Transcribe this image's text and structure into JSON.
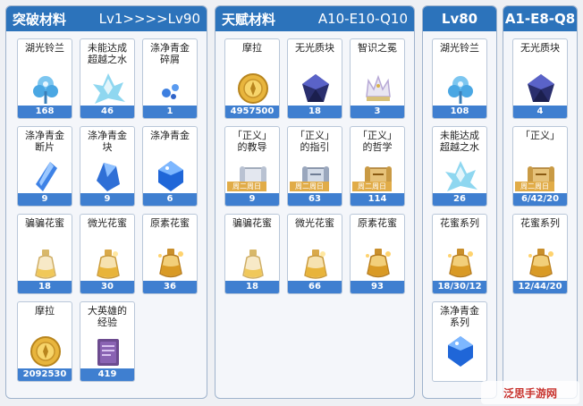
{
  "panels": {
    "breakthrough": {
      "title": "突破材料",
      "range": "Lv1>>>>Lv90",
      "items": [
        {
          "name": "湖光铃兰",
          "count": "168",
          "icon": "lake-lily-icon"
        },
        {
          "name": "未能达成\n超越之水",
          "count": "46",
          "icon": "water-crystal-icon"
        },
        {
          "name": "涤净青金\n碎屑",
          "count": "1",
          "icon": "lapis-sliver-icon"
        },
        {
          "name": "涤净青金\n断片",
          "count": "9",
          "icon": "lapis-fragment-icon"
        },
        {
          "name": "涤净青金\n块",
          "count": "9",
          "icon": "lapis-chunk-icon"
        },
        {
          "name": "涤净青金",
          "count": "6",
          "icon": "lapis-gemstone-icon"
        },
        {
          "name": "骗骗花蜜",
          "count": "18",
          "icon": "nectar-bottle-icon"
        },
        {
          "name": "微光花蜜",
          "count": "30",
          "icon": "shimmering-nectar-icon"
        },
        {
          "name": "原素花蜜",
          "count": "36",
          "icon": "energy-nectar-icon"
        },
        {
          "name": "摩拉",
          "count": "2092530",
          "icon": "mora-coin-icon"
        },
        {
          "name": "大英雄的\n经验",
          "count": "419",
          "icon": "hero-wit-book-icon"
        }
      ]
    },
    "talent": {
      "title": "天赋材料",
      "range": "A10-E10-Q10",
      "items": [
        {
          "name": "摩拉",
          "count": "4957500",
          "icon": "mora-coin-icon"
        },
        {
          "name": "无光质块",
          "count": "18",
          "icon": "lightless-mass-icon"
        },
        {
          "name": "智识之冕",
          "count": "3",
          "icon": "crown-of-insight-icon"
        },
        {
          "name": "「正义」\n的教导",
          "count": "9",
          "icon": "justice-teachings-icon",
          "tag": "周二周日"
        },
        {
          "name": "「正义」\n的指引",
          "count": "63",
          "icon": "justice-guide-icon",
          "tag": "周二周日"
        },
        {
          "name": "「正义」\n的哲学",
          "count": "114",
          "icon": "justice-philosophies-icon",
          "tag": "周二周日"
        },
        {
          "name": "骗骗花蜜",
          "count": "18",
          "icon": "nectar-bottle-icon"
        },
        {
          "name": "微光花蜜",
          "count": "66",
          "icon": "shimmering-nectar-icon"
        },
        {
          "name": "原素花蜜",
          "count": "93",
          "icon": "energy-nectar-icon"
        }
      ]
    },
    "lv80": {
      "title": "Lv80",
      "items": [
        {
          "name": "湖光铃兰",
          "count": "108",
          "icon": "lake-lily-icon"
        },
        {
          "name": "未能达成\n超越之水",
          "count": "26",
          "icon": "water-crystal-icon"
        },
        {
          "name": "花蜜系列",
          "count": "18/30/12",
          "icon": "energy-nectar-icon"
        },
        {
          "name": "涤净青金\n系列",
          "count": "",
          "icon": "lapis-gemstone-icon"
        }
      ]
    },
    "a1e8q8": {
      "title": "A1-E8-Q8",
      "items": [
        {
          "name": "无光质块",
          "count": "4",
          "icon": "lightless-mass-icon"
        },
        {
          "name": "「正义」",
          "count": "6/42/20",
          "icon": "justice-philosophies-icon",
          "tag": "周二周日"
        },
        {
          "name": "花蜜系列",
          "count": "12/44/20",
          "icon": "energy-nectar-icon"
        }
      ]
    }
  },
  "watermark": "泛思手游网"
}
